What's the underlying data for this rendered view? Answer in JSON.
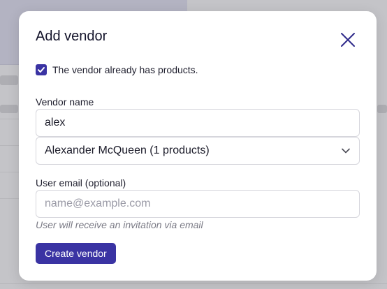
{
  "modal": {
    "title": "Add vendor",
    "close_icon": "close-icon",
    "checkbox": {
      "checked": true,
      "label": "The vendor already has products."
    },
    "vendor_name": {
      "label": "Vendor name",
      "value": "alex"
    },
    "vendor_select": {
      "selected": "Alexander McQueen (1 products)",
      "icon": "chevron-down-icon"
    },
    "user_email": {
      "label": "User email (optional)",
      "placeholder": "name@example.com",
      "value": "",
      "hint": "User will receive an invitation via email"
    },
    "submit_label": "Create vendor"
  },
  "colors": {
    "accent": "#3a33a3",
    "backdrop": "#c4c4c8",
    "modal_bg": "#ffffff"
  }
}
